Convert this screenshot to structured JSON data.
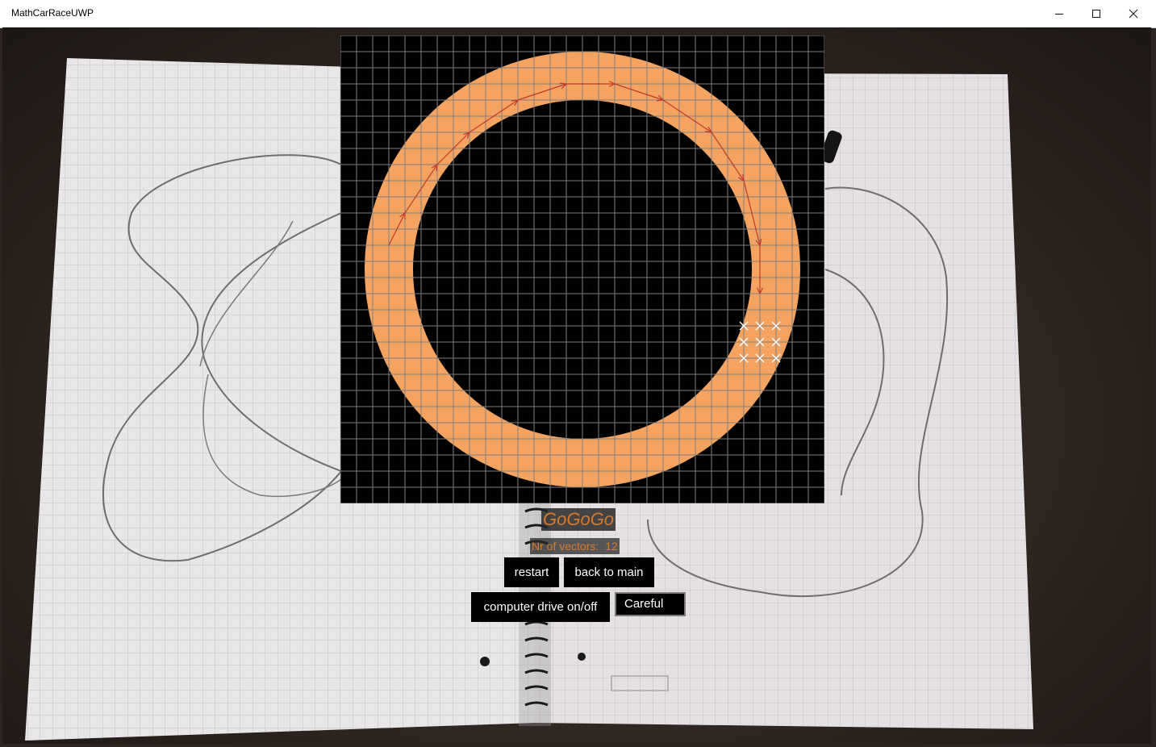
{
  "window": {
    "title": "MathCarRaceUWP",
    "controls": {
      "minimize": "minimize-icon",
      "maximize": "maximize-icon",
      "close": "close-icon"
    }
  },
  "game": {
    "grid": {
      "columns": 30,
      "rows": 29
    },
    "colors": {
      "background": "#000000",
      "grid": "#7f7f7f",
      "track": "#f4a460",
      "path": "#c0392b",
      "start_marks": "#ffffff"
    },
    "car_path": [
      [
        3,
        13
      ],
      [
        4,
        11
      ],
      [
        6,
        8
      ],
      [
        8,
        6
      ],
      [
        11,
        4
      ],
      [
        14,
        3
      ],
      [
        17,
        3
      ],
      [
        20,
        4
      ],
      [
        23,
        6
      ],
      [
        25,
        9
      ],
      [
        26,
        13
      ],
      [
        26,
        16
      ]
    ],
    "start_positions": [
      [
        25,
        18
      ],
      [
        26,
        18
      ],
      [
        27,
        18
      ],
      [
        25,
        19
      ],
      [
        26,
        19
      ],
      [
        27,
        19
      ],
      [
        25,
        20
      ],
      [
        26,
        20
      ],
      [
        27,
        20
      ]
    ]
  },
  "status": {
    "title": "GoGoGo",
    "vectors_label": "Nr of vectors:",
    "vectors_count": "12"
  },
  "buttons": {
    "restart": "restart",
    "back_to_main": "back to main",
    "computer_drive": "computer drive on/off"
  },
  "driving_mode": {
    "selected": "Careful"
  }
}
